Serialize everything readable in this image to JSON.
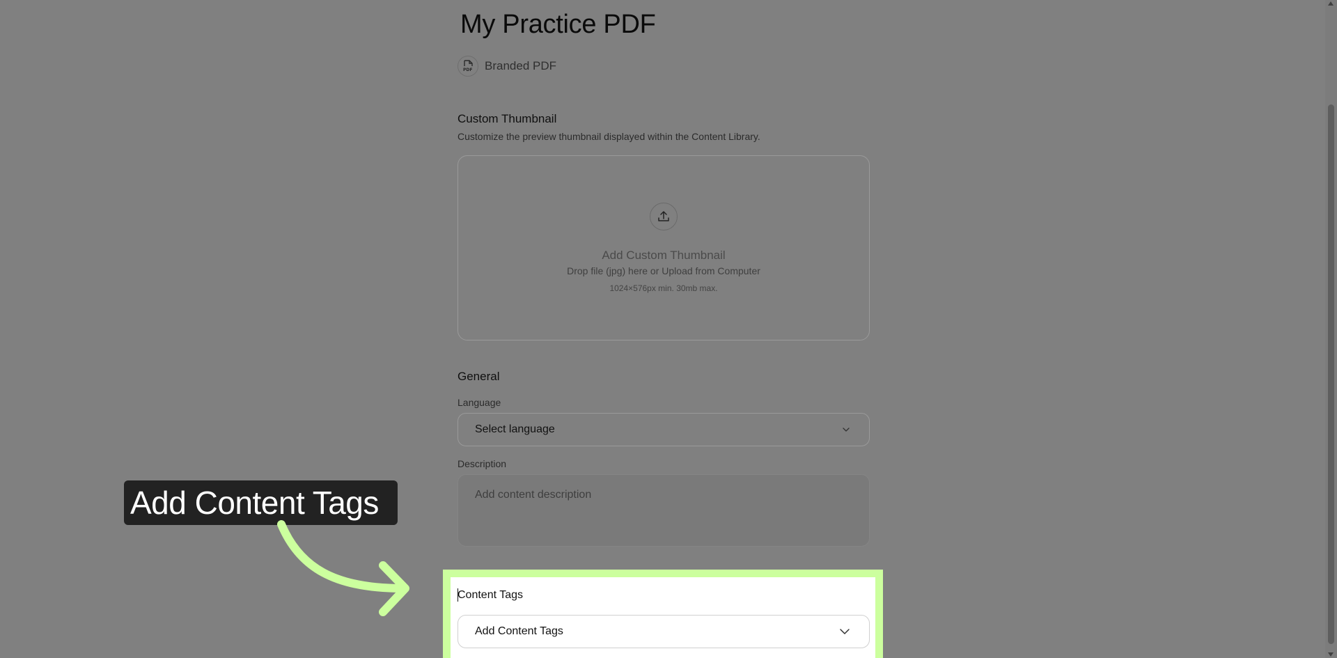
{
  "page": {
    "title": "My Practice PDF",
    "content_type": "Branded PDF",
    "content_type_icon": "pdf-file-icon"
  },
  "thumbnail": {
    "section_title": "Custom Thumbnail",
    "section_description": "Customize the preview thumbnail displayed within the Content Library.",
    "upload_icon": "upload-icon",
    "upload_title": "Add Custom Thumbnail",
    "upload_subtitle": "Drop file (jpg) here or Upload from Computer",
    "upload_note": "1024×576px min. 30mb max."
  },
  "general": {
    "section_title": "General",
    "language_label": "Language",
    "language_value": "Select language",
    "description_label": "Description",
    "description_placeholder": "Add content description"
  },
  "content_tags": {
    "label": "Content Tags",
    "select_value": "Add Content Tags"
  },
  "callout": {
    "text": "Add Content Tags"
  },
  "colors": {
    "overlay": "#808080",
    "highlight_border": "#ccff9e",
    "callout_bg": "#222222",
    "arrow": "#ccff9e"
  }
}
